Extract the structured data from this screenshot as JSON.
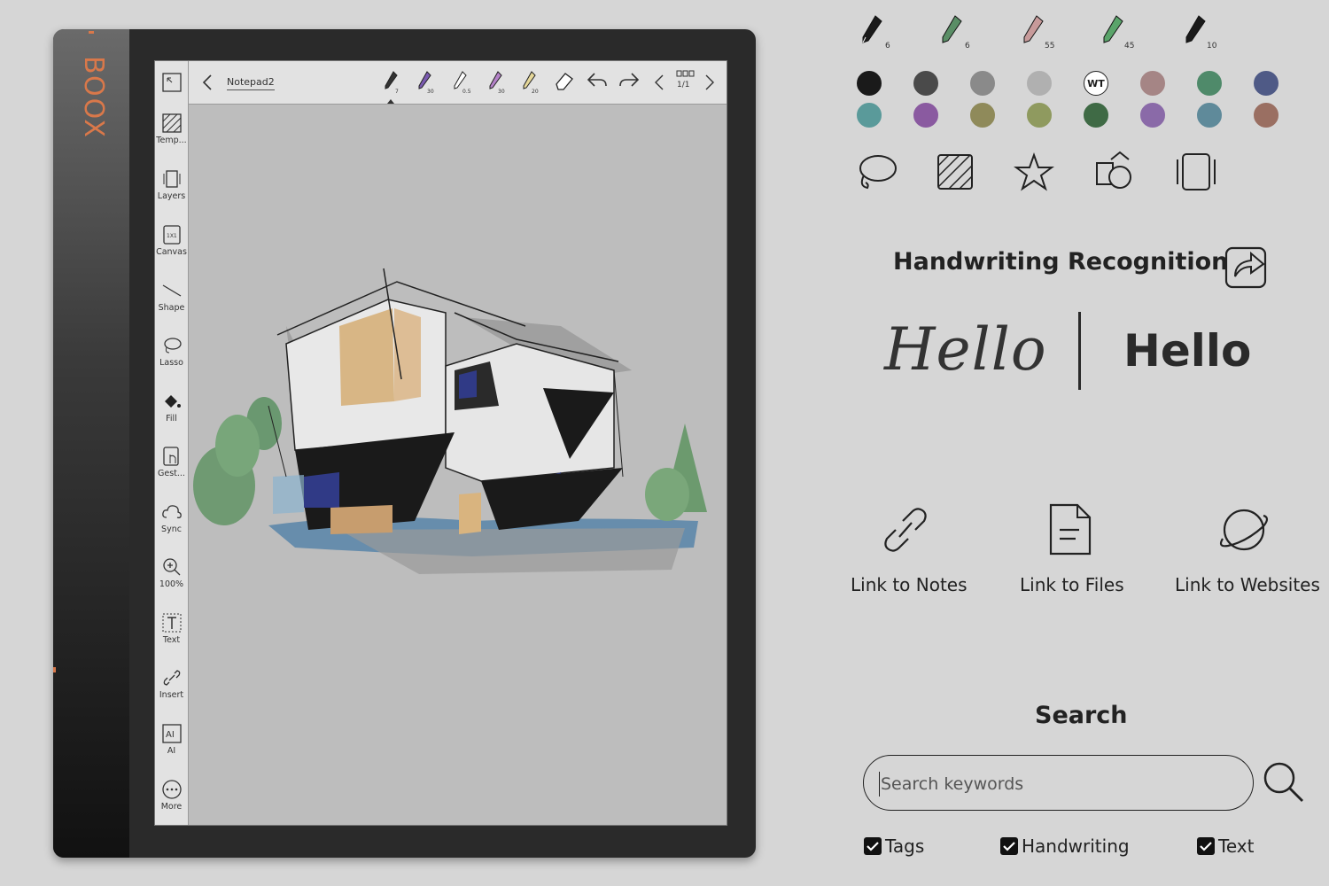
{
  "device": {
    "brand": "BOOX",
    "notebook_title": "Notepad2",
    "page_indicator": "1/1",
    "pen_sizes": [
      "7",
      "30",
      "0.5",
      "30",
      "20"
    ],
    "sidebar": [
      {
        "label": "Temp...",
        "icon": "template-icon"
      },
      {
        "label": "Layers",
        "icon": "layers-icon"
      },
      {
        "label": "Canvas",
        "icon": "canvas-icon"
      },
      {
        "label": "Shape",
        "icon": "shape-icon"
      },
      {
        "label": "Lasso",
        "icon": "lasso-icon"
      },
      {
        "label": "Fill",
        "icon": "fill-icon"
      },
      {
        "label": "Gest...",
        "icon": "gesture-icon"
      },
      {
        "label": "Sync",
        "icon": "sync-icon"
      },
      {
        "label": "100%",
        "icon": "zoom-icon"
      },
      {
        "label": "Text",
        "icon": "text-icon"
      },
      {
        "label": "Insert",
        "icon": "insert-link-icon"
      },
      {
        "label": "AI",
        "icon": "ai-icon"
      },
      {
        "label": "More",
        "icon": "more-icon"
      }
    ]
  },
  "pens": [
    {
      "size": "6",
      "color": "#1a1a1a"
    },
    {
      "size": "6",
      "color": "#5a8e66"
    },
    {
      "size": "55",
      "color": "#c79a9a"
    },
    {
      "size": "45",
      "color": "#5aa46a"
    },
    {
      "size": "10",
      "color": "#1a1a1a"
    }
  ],
  "palette": {
    "row1": [
      "#1a1a1a",
      "#4a4a4a",
      "#8a8a8a",
      "#b0b0b0",
      "WT",
      "#a58585",
      "#4f8a6a",
      "#4f5a86"
    ],
    "row2": [
      "#5a9a9a",
      "#8a5aa0",
      "#8f8a5a",
      "#8f9a5f",
      "#3f6a45",
      "#8a6aa8",
      "#5f8a9a",
      "#9a6f62"
    ],
    "wt_label": "WT"
  },
  "tools_icons": [
    "lasso-icon",
    "template-icon",
    "star-shape-icon",
    "shapes-icon",
    "layers-icon"
  ],
  "handwriting": {
    "title": "Handwriting Recognition",
    "script_text": "Hello",
    "recognized_text": "Hello"
  },
  "links": [
    {
      "label": "Link to Notes",
      "icon": "chain-link-icon"
    },
    {
      "label": "Link to Files",
      "icon": "file-icon"
    },
    {
      "label": "Link to Websites",
      "icon": "planet-icon"
    }
  ],
  "search": {
    "title": "Search",
    "placeholder": "Search keywords",
    "filters": [
      {
        "label": "Tags",
        "checked": true
      },
      {
        "label": "Handwriting",
        "checked": true
      },
      {
        "label": "Text",
        "checked": true
      }
    ]
  }
}
